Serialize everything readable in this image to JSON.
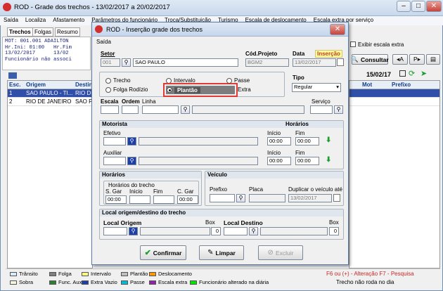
{
  "main": {
    "title": "ROD - Grade dos trechos - 13/02/2017 a 20/02/2017",
    "menu": [
      "Saída",
      "Localiza",
      "Afastamento",
      "Parâmetros do funcionário",
      "Troca/Substituição",
      "Turismo",
      "Escala de deslocamento",
      "Escala extra por serviço"
    ],
    "tabs": [
      "Trechos",
      "Folgas",
      "Resumo"
    ],
    "info": "MOT: 001.001 ADAILTON\nHr.Ini: 01:00   Hr.Fim\n13/02/2017      13/02\nFuncionário não associ",
    "exibir_escala_extra": "Exibir escala extra",
    "consultar": "Consultar",
    "date": "15/02/17",
    "grid_headers": [
      "Esc.",
      "Origem",
      "Destin",
      "Mot",
      "Prefixo"
    ],
    "grid_rows": [
      {
        "esc": "1",
        "origem": "SAO PAULO - TI...",
        "destino": "RIO DE"
      },
      {
        "esc": "2",
        "origem": "RIO DE JANEIRO",
        "destino": "SAO P"
      }
    ],
    "legend": [
      "Trânsito",
      "Folga",
      "Intervalo",
      "Plantão",
      "Deslocamento",
      "Sobra",
      "Func. Aux",
      "Extra Vazio",
      "Passe",
      "Escala extra",
      "Funcionário alterado na diária"
    ],
    "status_red": "F6 ou (+) - Alteração  F7 - Pesquisa",
    "status_black": "Trecho não roda no dia"
  },
  "dialog": {
    "title": "ROD - Inserção grade dos trechos",
    "menu": "Saída",
    "setor_label": "Setor",
    "setor_code": "001",
    "setor_name": "SAO PAULO",
    "cod_projeto_label": "Cód.Projeto",
    "cod_projeto": "BGM2",
    "data_label": "Data",
    "data_value": "13/02/2017",
    "insercao": "Inserção",
    "options": [
      "Trecho",
      "Folga Rodízio",
      "Intervalo",
      "Plantão",
      "Passe",
      "Extra"
    ],
    "tipo_label": "Tipo",
    "tipo_value": "Regular",
    "escala_label": "Escala",
    "ordem_label": "Ordem",
    "linha_label": "Linha",
    "servico_label": "Serviço",
    "motorista_label": "Motorista",
    "horarios_label": "Horários",
    "efetivo_label": "Efetivo",
    "auxiliar_label": "Auxiliar",
    "inicio_label": "Início",
    "fim_label": "Fim",
    "time": "00:00",
    "horarios_do_trecho_label": "Horários do trecho",
    "sgar_label": "S. Gar",
    "inicio2_label": "Inicio",
    "fim2_label": "Fim",
    "cgar_label": "C. Gar",
    "veiculo_label": "Veículo",
    "prefixo_label": "Prefixo",
    "placa_label": "Placa",
    "duplicar_label": "Duplicar o veículo até",
    "duplicar_value": "13/02/2017",
    "local_section": "Local origem/destino do trecho",
    "local_origem_label": "Local Origem",
    "local_destino_label": "Local Destino",
    "box_label": "Box",
    "box_value": "0",
    "confirmar": "Confirmar",
    "limpar": "Limpar",
    "excluir": "Excluir"
  },
  "colors": {
    "highlight": "#e53935",
    "selection": "#2f4fa8",
    "plantao": "#7d7d7d",
    "insercao_bg": "#ffff99",
    "insercao_text": "#c0392b"
  }
}
